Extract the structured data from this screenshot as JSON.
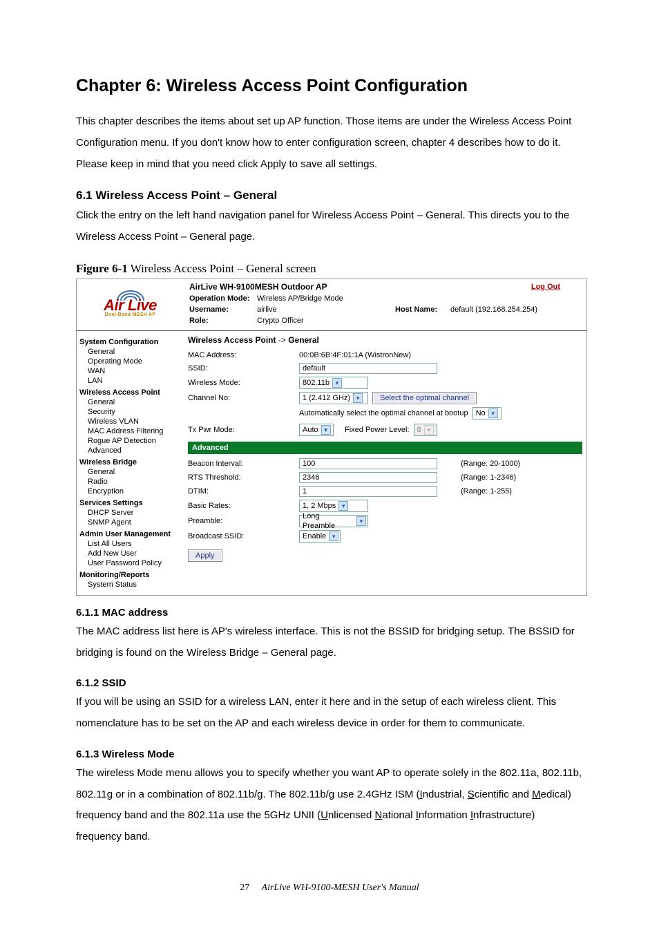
{
  "chapter_title": "Chapter 6: Wireless Access Point Configuration",
  "intro": "This chapter describes the items about set up AP function. Those items are under the Wireless Access Point Configuration menu. If you don't know how to enter configuration screen, chapter 4 describes how to do it. Please keep in mind that you need click Apply to save all settings.",
  "s61_h": "6.1 Wireless Access Point – General",
  "s61_p": "Click the entry on the left hand navigation panel for Wireless Access Point – General. This directs you to the Wireless Access Point – General page.",
  "fig_bold": "Figure 6-1",
  "fig_rest": " Wireless Access Point – General screen",
  "s611_h": "6.1.1 MAC address",
  "s611_p": "The MAC address list here is AP's wireless interface. This is not the BSSID for bridging setup. The BSSID for bridging is found on the Wireless Bridge – General page.",
  "s612_h": "6.1.2 SSID",
  "s612_p": "If you will be using an SSID for a wireless LAN, enter it here and in the setup of each wireless client. This nomenclature has to be set on the AP and each wireless device in order for them to communicate.",
  "s613_h": "6.1.3 Wireless Mode",
  "s613_p_a": "The wireless Mode menu allows you to specify whether you want AP to operate solely in the 802.11a, 802.11b, 802.11g or in a combination of 802.11b/g. The 802.11b/g use 2.4GHz ISM (",
  "s613_p_b": "ndustrial, ",
  "s613_p_c": "cientific and ",
  "s613_p_d": "edical) frequency band and the 802.11a use the 5GHz UNII (",
  "s613_p_e": "nlicensed ",
  "s613_p_f": "ational ",
  "s613_p_g": "nformation ",
  "s613_p_h": "nfrastructure) frequency band.",
  "ul": {
    "I": "I",
    "S": "S",
    "M": "M",
    "U": "U",
    "N": "N"
  },
  "footer_page": "27",
  "footer_title": "AirLive WH-9100-MESH User's Manual",
  "shot": {
    "device": "AirLive WH-9100MESH Outdoor AP",
    "logout": "Log Out",
    "logo_main": "Air Live",
    "logo_sub": "Dual-Band MESH AP",
    "meta": {
      "opmode_lbl": "Operation Mode:",
      "opmode_val": "Wireless AP/Bridge Mode",
      "user_lbl": "Username:",
      "user_val": "airlive",
      "role_lbl": "Role:",
      "role_val": "Crypto Officer",
      "host_lbl": "Host Name:",
      "host_val": "default (192.168.254.254)"
    },
    "nav": {
      "cat1": "System Configuration",
      "c1": [
        "General",
        "Operating Mode",
        "WAN",
        "LAN"
      ],
      "cat2": "Wireless Access Point",
      "c2": [
        "General",
        "Security",
        "Wireless VLAN",
        "MAC Address Filtering",
        "Rogue AP Detection",
        "Advanced"
      ],
      "cat3": "Wireless Bridge",
      "c3": [
        "General",
        "Radio",
        "Encryption"
      ],
      "cat4": "Services Settings",
      "c4": [
        "DHCP Server",
        "SNMP Agent"
      ],
      "cat5": "Admin User Management",
      "c5": [
        "List All Users",
        "Add New User",
        "User Password Policy"
      ],
      "cat6": "Monitoring/Reports",
      "c6": [
        "System Status"
      ]
    },
    "crumb_a": "Wireless Access Point",
    "crumb_arrow": " -> ",
    "crumb_b": "General",
    "labels": {
      "mac": "MAC Address:",
      "ssid": "SSID:",
      "wmode": "Wireless Mode:",
      "chno": "Channel No:",
      "txpwr": "Tx Pwr Mode:",
      "beacon": "Beacon Interval:",
      "rts": "RTS Threshold:",
      "dtim": "DTIM:",
      "basic": "Basic Rates:",
      "preamble": "Preamble:",
      "bcast": "Broadcast SSID:"
    },
    "vals": {
      "mac": "00:0B:6B:4F:01:1A (WistronNew)",
      "ssid": "default",
      "wmode": "802.11b",
      "chno": "1 (2.412 GHz)",
      "opt_btn": "Select the optimal channel",
      "auto_lbl": "Automatically select the optimal channel at bootup",
      "auto_sel": "No",
      "txpwr": "Auto",
      "fixed_lbl": "Fixed Power Level:",
      "fixed_sel": "8",
      "advanced": "Advanced",
      "beacon": "100",
      "beacon_rng": "(Range: 20-1000)",
      "rts": "2346",
      "rts_rng": "(Range: 1-2346)",
      "dtim": "1",
      "dtim_rng": "(Range: 1-255)",
      "basic": "1, 2 Mbps",
      "preamble": "Long Preamble",
      "bcast": "Enable",
      "apply": "Apply"
    }
  }
}
